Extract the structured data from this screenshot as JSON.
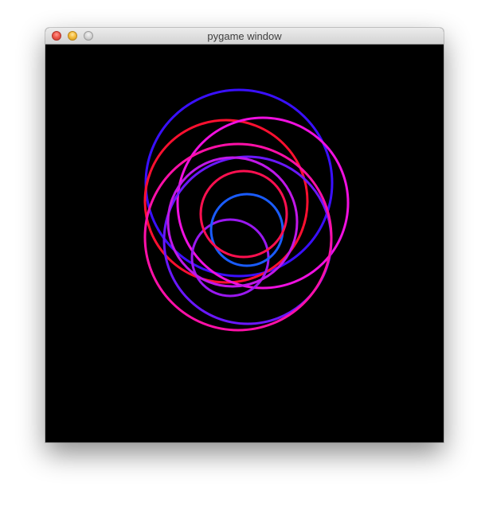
{
  "window": {
    "title": "pygame window",
    "buttons": {
      "close": "close-button",
      "minimize": "minimize-button",
      "zoom": "zoom-button"
    }
  },
  "canvas": {
    "background": "#000000",
    "circles": [
      {
        "name": "circle-blue-large",
        "color": "#3a10ff"
      },
      {
        "name": "circle-red-large",
        "color": "#ff1030"
      },
      {
        "name": "circle-magenta-large",
        "color": "#f010e0"
      },
      {
        "name": "circle-purple-mid",
        "color": "#6a18ff"
      },
      {
        "name": "circle-pink-mid",
        "color": "#ff10a8"
      },
      {
        "name": "circle-violet-small",
        "color": "#9a18f0"
      },
      {
        "name": "circle-blue-small",
        "color": "#1a5cff"
      },
      {
        "name": "circle-magenta-mid",
        "color": "#c018e8"
      },
      {
        "name": "circle-crimson-large",
        "color": "#ff1050"
      }
    ]
  }
}
